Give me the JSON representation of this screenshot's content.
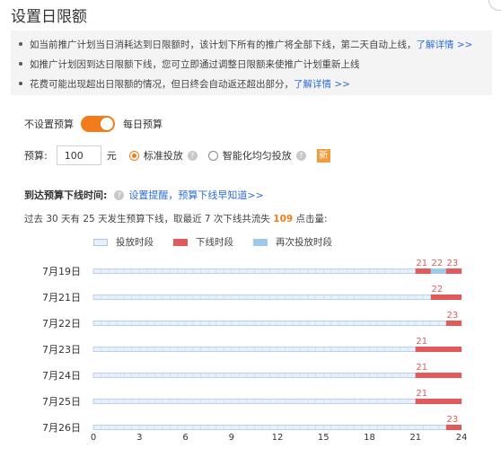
{
  "title": "设置日限额",
  "notices": [
    {
      "text": "如当前推广计划当日消耗达到日限额时，该计划下所有的推广将全部下线，第二天自动上线，",
      "link": "了解详情 >>"
    },
    {
      "text": "如推广计划因到达日限额下线，您可立即通过调整日限额来使推广计划重新上线",
      "link": ""
    },
    {
      "text": "花费可能出现超出日限额的情况，但日终会自动返还超出部分，",
      "link": "了解详情 >>"
    }
  ],
  "budget_switch": {
    "off_label": "不设置预算",
    "on_label": "每日预算",
    "state": "on"
  },
  "budget": {
    "label": "预算:",
    "value": "100",
    "unit": "元",
    "options": [
      {
        "label": "标准投放",
        "selected": true
      },
      {
        "label": "智能化均匀投放",
        "selected": false
      }
    ],
    "new_badge": "新"
  },
  "offline_section": {
    "title": "到达预算下线时间:",
    "link": "设置提醒，预算下线早知道>>",
    "summary_prefix": "过去 30 天有 25 天发生预算下线，取最近 7 次下线共流失",
    "lost_clicks": "109",
    "summary_suffix": "点击量:"
  },
  "legend": {
    "normal": "投放时段",
    "offline": "下线时段",
    "again": "再次投放时段"
  },
  "colors": {
    "accent": "#f27c1a",
    "offline": "#e25a5a",
    "normal": "#e8f1fb",
    "again": "#9fc8ef",
    "link": "#2f6ed3"
  },
  "chart_data": {
    "type": "timeline",
    "x_ticks": [
      0,
      3,
      6,
      9,
      12,
      15,
      18,
      21,
      24
    ],
    "xlim": [
      0,
      24
    ],
    "rows": [
      {
        "date": "7月19日",
        "segments": [
          {
            "start": 21,
            "end": 22,
            "kind": "offline"
          },
          {
            "start": 22,
            "end": 23,
            "kind": "again"
          },
          {
            "start": 23,
            "end": 24,
            "kind": "offline"
          }
        ],
        "labels": [
          "21",
          "22",
          "23"
        ]
      },
      {
        "date": "7月21日",
        "segments": [
          {
            "start": 22,
            "end": 24,
            "kind": "offline"
          }
        ],
        "labels": [
          "22"
        ]
      },
      {
        "date": "7月22日",
        "segments": [
          {
            "start": 23,
            "end": 24,
            "kind": "offline"
          }
        ],
        "labels": [
          "23"
        ]
      },
      {
        "date": "7月23日",
        "segments": [
          {
            "start": 21,
            "end": 24,
            "kind": "offline"
          }
        ],
        "labels": [
          "21"
        ]
      },
      {
        "date": "7月24日",
        "segments": [
          {
            "start": 21,
            "end": 24,
            "kind": "offline"
          }
        ],
        "labels": [
          "21"
        ]
      },
      {
        "date": "7月25日",
        "segments": [
          {
            "start": 21,
            "end": 24,
            "kind": "offline"
          }
        ],
        "labels": [
          "21"
        ]
      },
      {
        "date": "7月26日",
        "segments": [
          {
            "start": 23,
            "end": 24,
            "kind": "offline"
          }
        ],
        "labels": [
          "23"
        ]
      }
    ]
  }
}
